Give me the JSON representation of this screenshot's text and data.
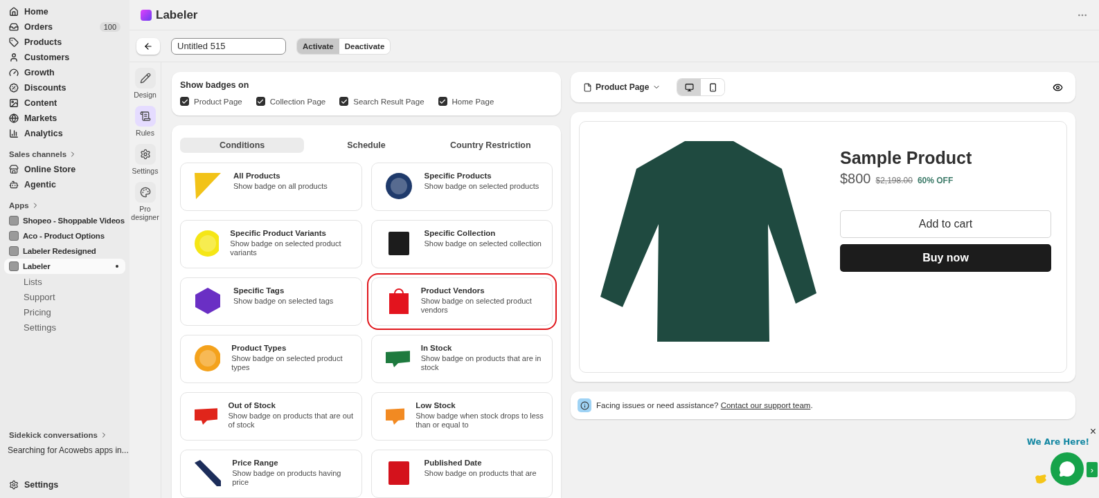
{
  "sidebar": {
    "nav": [
      {
        "label": "Home"
      },
      {
        "label": "Orders",
        "count": "100"
      },
      {
        "label": "Products"
      },
      {
        "label": "Customers"
      },
      {
        "label": "Growth"
      },
      {
        "label": "Discounts"
      },
      {
        "label": "Content"
      },
      {
        "label": "Markets"
      },
      {
        "label": "Analytics"
      }
    ],
    "sales_channels": {
      "heading": "Sales channels",
      "items": [
        {
          "label": "Online Store"
        },
        {
          "label": "Agentic"
        }
      ]
    },
    "apps": {
      "heading": "Apps",
      "items": [
        {
          "label": "Shopeo - Shoppable Videos",
          "selected": false
        },
        {
          "label": "Aco - Product Options",
          "selected": false
        },
        {
          "label": "Labeler Redesigned",
          "selected": false
        },
        {
          "label": "Labeler",
          "selected": true,
          "children": [
            {
              "label": "Lists"
            },
            {
              "label": "Support"
            },
            {
              "label": "Pricing"
            },
            {
              "label": "Settings"
            }
          ]
        }
      ]
    },
    "sidekick": {
      "heading": "Sidekick conversations",
      "item": "Searching for Acowebs apps in..."
    },
    "settings": "Settings"
  },
  "header": {
    "app_name": "Labeler"
  },
  "toolbar": {
    "name_value": "Untitled 515",
    "status": [
      {
        "label": "Activate",
        "selected": true
      },
      {
        "label": "Deactivate",
        "selected": false
      }
    ]
  },
  "rail": [
    {
      "label": "Design",
      "selected": false
    },
    {
      "label": "Rules",
      "selected": true
    },
    {
      "label": "Settings",
      "selected": false
    },
    {
      "label": "Pro designer",
      "selected": false
    }
  ],
  "show_badges": {
    "title": "Show badges on",
    "options": [
      {
        "label": "Product Page",
        "checked": true
      },
      {
        "label": "Collection Page",
        "checked": true
      },
      {
        "label": "Search Result Page",
        "checked": true
      },
      {
        "label": "Home Page",
        "checked": true
      }
    ]
  },
  "tabs": [
    {
      "label": "Conditions",
      "selected": true
    },
    {
      "label": "Schedule",
      "selected": false
    },
    {
      "label": "Country Restriction",
      "selected": false
    }
  ],
  "conditions": [
    {
      "title": "All Products",
      "description": "Show badge on all products",
      "kind": "corner",
      "color": "#f2c318",
      "highlighted": false
    },
    {
      "title": "Specific Products",
      "description": "Show badge on selected products",
      "kind": "round",
      "color": "#1f3a6b",
      "highlighted": false
    },
    {
      "title": "Specific Product Variants",
      "description": "Show badge on selected product variants",
      "kind": "round",
      "color": "#f5e616",
      "highlighted": false
    },
    {
      "title": "Specific Collection",
      "description": "Show badge on selected collection",
      "kind": "block",
      "color": "#1c1c1c",
      "highlighted": false
    },
    {
      "title": "Specific Tags",
      "description": "Show badge on selected tags",
      "kind": "hexagon",
      "color": "#6a2fc4",
      "highlighted": false
    },
    {
      "title": "Product Vendors",
      "description": "Show badge on selected product vendors",
      "kind": "bag",
      "color": "#e3141e",
      "highlighted": true
    },
    {
      "title": "Product Types",
      "description": "Show badge on selected product types",
      "kind": "round",
      "color": "#f4a21c",
      "highlighted": false
    },
    {
      "title": "In Stock",
      "description": "Show badge on products that are in stock",
      "kind": "banner",
      "color": "#1e7a3e",
      "highlighted": false
    },
    {
      "title": "Out of Stock",
      "description": "Show badge on products that are out of stock",
      "kind": "banner",
      "color": "#e0251b",
      "highlighted": false
    },
    {
      "title": "Low Stock",
      "description": "Show badge when stock drops to less than or equal to",
      "kind": "banner",
      "color": "#f28a22",
      "highlighted": false
    },
    {
      "title": "Price Range",
      "description": "Show badge on products having price",
      "kind": "sash",
      "color": "#1c2d5a",
      "highlighted": false
    },
    {
      "title": "Published Date",
      "description": "Show badge on products that are",
      "kind": "block",
      "color": "#d4121c",
      "highlighted": false
    }
  ],
  "preview": {
    "page": "Product Page",
    "devices": [
      {
        "kind": "desktop",
        "selected": true
      },
      {
        "kind": "mobile",
        "selected": false
      }
    ],
    "product": {
      "title": "Sample Product",
      "price": "$800",
      "compare_price": "$2,198.00",
      "discount": "60% OFF",
      "add_to_cart": "Add to cart",
      "buy_now": "Buy now"
    }
  },
  "notice": {
    "text": "Facing issues or need assistance?",
    "link": "Contact our support team",
    "end": "."
  },
  "chat": {
    "greeting": "We Are Here!",
    "close": "×",
    "expand": "›"
  }
}
